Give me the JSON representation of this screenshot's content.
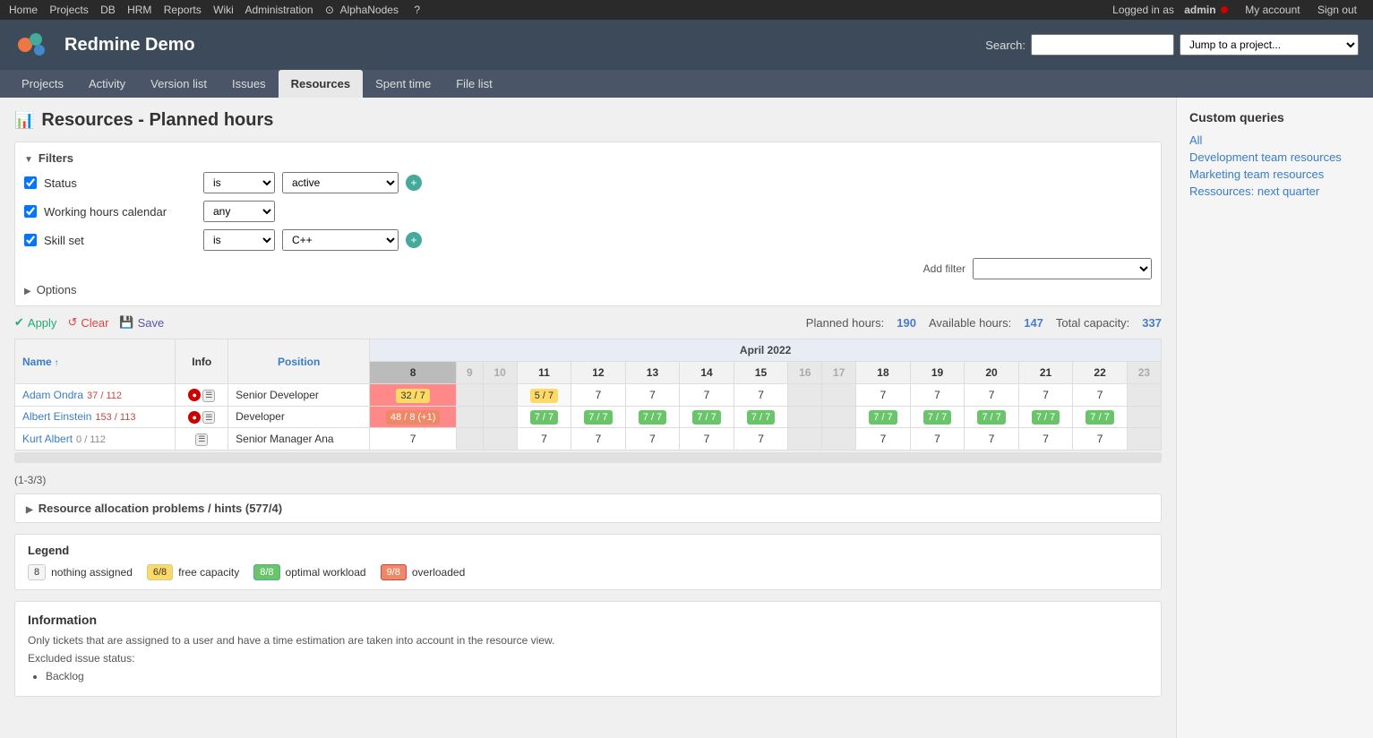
{
  "topbar": {
    "nav_links": [
      "Home",
      "Projects",
      "DB",
      "HRM",
      "Reports",
      "Wiki",
      "Administration",
      "AlphaNodes"
    ],
    "right_text": "Logged in as",
    "username": "admin",
    "account_link": "My account",
    "signout_link": "Sign out"
  },
  "header": {
    "app_name": "Redmine Demo",
    "search_label": "Search:",
    "search_placeholder": "",
    "jump_placeholder": "Jump to a project..."
  },
  "nav": {
    "items": [
      "Projects",
      "Activity",
      "Version list",
      "Issues",
      "Resources",
      "Spent time",
      "File list"
    ],
    "active": "Resources"
  },
  "page": {
    "title": "Resources - Planned hours",
    "icon": "📊"
  },
  "filters": {
    "header": "Filters",
    "rows": [
      {
        "enabled": true,
        "label": "Status",
        "operator": "is",
        "value": "active"
      },
      {
        "enabled": true,
        "label": "Working hours calendar",
        "operator": "any",
        "value": ""
      },
      {
        "enabled": true,
        "label": "Skill set",
        "operator": "is",
        "value": "C++"
      }
    ],
    "add_filter_label": "Add filter",
    "options_label": "Options"
  },
  "actions": {
    "apply": "Apply",
    "clear": "Clear",
    "save": "Save"
  },
  "summary": {
    "planned_label": "Planned hours:",
    "planned_val": "190",
    "available_label": "Available hours:",
    "available_val": "147",
    "capacity_label": "Total capacity:",
    "capacity_val": "337"
  },
  "table": {
    "month": "April 2022",
    "col_headers": [
      "Name",
      "Info",
      "Position"
    ],
    "day_headers": [
      "8",
      "9",
      "10",
      "11",
      "12",
      "13",
      "14",
      "15",
      "16",
      "17",
      "18",
      "19",
      "20",
      "21",
      "22",
      "23"
    ],
    "rows": [
      {
        "name": "Adam Ondra",
        "hours_used": "37",
        "hours_total": "112",
        "position": "Senior Developer",
        "extra": "",
        "cells": {
          "8": {
            "type": "free",
            "val": "32 / 7"
          },
          "9": {
            "type": "normal",
            "val": ""
          },
          "10": {
            "type": "normal",
            "val": ""
          },
          "11": {
            "type": "free",
            "val": "5 / 7"
          },
          "12": {
            "type": "plain",
            "val": "7"
          },
          "13": {
            "type": "plain",
            "val": "7"
          },
          "14": {
            "type": "plain",
            "val": "7"
          },
          "15": {
            "type": "plain",
            "val": "7"
          },
          "16": {
            "type": "weekend",
            "val": ""
          },
          "17": {
            "type": "weekend",
            "val": ""
          },
          "18": {
            "type": "plain",
            "val": "7"
          },
          "19": {
            "type": "plain",
            "val": "7"
          },
          "20": {
            "type": "plain",
            "val": "7"
          },
          "21": {
            "type": "plain",
            "val": "7"
          },
          "22": {
            "type": "plain",
            "val": "7"
          },
          "23": {
            "type": "weekend",
            "val": ""
          }
        }
      },
      {
        "name": "Albert Einstein",
        "hours_used": "153",
        "hours_total": "113",
        "position": "Developer",
        "extra": "",
        "cells": {
          "8": {
            "type": "overload",
            "val": "48 / 8 (+1)"
          },
          "9": {
            "type": "normal",
            "val": ""
          },
          "10": {
            "type": "normal",
            "val": ""
          },
          "11": {
            "type": "optimal",
            "val": "7 / 7"
          },
          "12": {
            "type": "optimal",
            "val": "7 / 7"
          },
          "13": {
            "type": "optimal",
            "val": "7 / 7"
          },
          "14": {
            "type": "optimal",
            "val": "7 / 7"
          },
          "15": {
            "type": "optimal",
            "val": "7 / 7"
          },
          "16": {
            "type": "weekend",
            "val": ""
          },
          "17": {
            "type": "weekend",
            "val": ""
          },
          "18": {
            "type": "optimal",
            "val": "7 / 7"
          },
          "19": {
            "type": "optimal",
            "val": "7 / 7"
          },
          "20": {
            "type": "optimal",
            "val": "7 / 7"
          },
          "21": {
            "type": "optimal",
            "val": "7 / 7"
          },
          "22": {
            "type": "optimal",
            "val": "7 / 7"
          },
          "23": {
            "type": "weekend",
            "val": ""
          }
        }
      },
      {
        "name": "Kurt Albert",
        "hours_used": "0",
        "hours_total": "112",
        "position": "Senior Manager",
        "extra": "Ana",
        "cells": {
          "8": {
            "type": "plain",
            "val": "7"
          },
          "9": {
            "type": "normal",
            "val": ""
          },
          "10": {
            "type": "normal",
            "val": ""
          },
          "11": {
            "type": "plain",
            "val": "7"
          },
          "12": {
            "type": "plain",
            "val": "7"
          },
          "13": {
            "type": "plain",
            "val": "7"
          },
          "14": {
            "type": "plain",
            "val": "7"
          },
          "15": {
            "type": "plain",
            "val": "7"
          },
          "16": {
            "type": "weekend",
            "val": ""
          },
          "17": {
            "type": "weekend",
            "val": ""
          },
          "18": {
            "type": "plain",
            "val": "7"
          },
          "19": {
            "type": "plain",
            "val": "7"
          },
          "20": {
            "type": "plain",
            "val": "7"
          },
          "21": {
            "type": "plain",
            "val": "7"
          },
          "22": {
            "type": "plain",
            "val": "7"
          },
          "23": {
            "type": "weekend",
            "val": ""
          }
        }
      }
    ],
    "pagination": "(1-3/3)"
  },
  "problems": {
    "title": "Resource allocation problems / hints (577/4)"
  },
  "legend": {
    "title": "Legend",
    "nothing_box": "8",
    "nothing_label": "nothing assigned",
    "free_box": "6/8",
    "free_label": "free capacity",
    "optimal_box": "8/8",
    "optimal_label": "optimal workload",
    "overload_box": "9/8",
    "overload_label": "overloaded"
  },
  "information": {
    "title": "Information",
    "text": "Only tickets that are assigned to a user and have a time estimation are taken into account in the resource view.",
    "excluded_label": "Excluded issue status:",
    "excluded_items": [
      "Backlog"
    ]
  },
  "sidebar": {
    "title": "Custom queries",
    "links": [
      {
        "label": "All",
        "type": "all"
      },
      {
        "label": "Development team resources",
        "type": "normal"
      },
      {
        "label": "Marketing team resources",
        "type": "normal"
      },
      {
        "label": "Ressources: next quarter",
        "type": "normal"
      }
    ]
  }
}
